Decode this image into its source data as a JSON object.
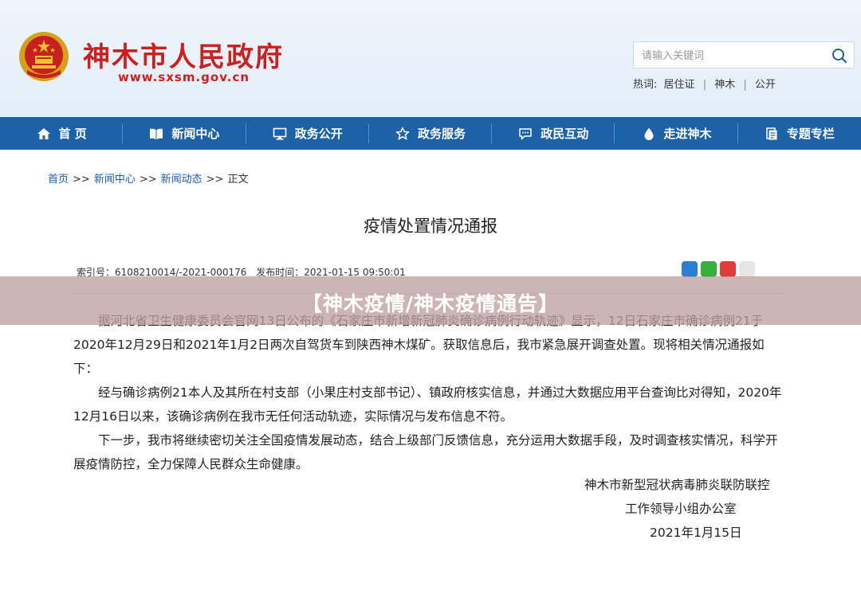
{
  "header": {
    "site_name": "神木市人民政府",
    "site_url": "www.sxsm.gov.cn",
    "search_placeholder": "请输入关键词",
    "hot_label": "热词:",
    "hot_words": [
      "居住证",
      "神木",
      "公开"
    ]
  },
  "nav": {
    "items": [
      {
        "label": "首 页",
        "icon": "home-icon"
      },
      {
        "label": "新闻中心",
        "icon": "book-icon"
      },
      {
        "label": "政务公开",
        "icon": "monitor-icon"
      },
      {
        "label": "政务服务",
        "icon": "star-icon"
      },
      {
        "label": "政民互动",
        "icon": "chat-icon"
      },
      {
        "label": "走进神木",
        "icon": "drop-icon"
      },
      {
        "label": "专题专栏",
        "icon": "document-icon"
      }
    ]
  },
  "breadcrumb": {
    "items": [
      "首页",
      "新闻中心",
      "新闻动态"
    ],
    "separator": ">>",
    "current": "正文"
  },
  "article": {
    "title": "疫情处置情况通报",
    "index_label": "索引号：",
    "index_value": "6108210014/-2021-000176",
    "publish_label": "发布时间：",
    "publish_value": "2021-01-15 09:50:01",
    "paragraphs": [
      "据河北省卫生健康委员会官网13日公布的《石家庄市新增新冠肺炎确诊病例行动轨迹》显示，12日石家庄市确诊病例21于2020年12月29日和2021年1月2日两次自驾货车到陕西神木煤矿。获取信息后，我市紧急展开调查处置。现将相关情况通报如下：",
      "经与确诊病例21本人及其所在村支部（小果庄村支部书记）、镇政府核实信息，并通过大数据应用平台查询比对得知，2020年12月16日以来，该确诊病例在我市无任何活动轨迹，实际情况与发布信息不符。",
      "下一步，我市将继续密切关注全国疫情发展动态，结合上级部门反馈信息，充分运用大数据手段，及时调查核实情况，科学开展疫情防控，全力保障人民群众生命健康。"
    ],
    "signature_line1": "神木市新型冠状病毒肺炎联防联控",
    "signature_line2": "工作领导小组办公室",
    "signature_date": "2021年1月15日"
  },
  "banner": {
    "text": "【神木疫情/神木疫情通告】"
  },
  "colors": {
    "brand_red": "#cc1f1f",
    "nav_blue": "#1d62a6",
    "link_blue": "#1d5ea8"
  }
}
